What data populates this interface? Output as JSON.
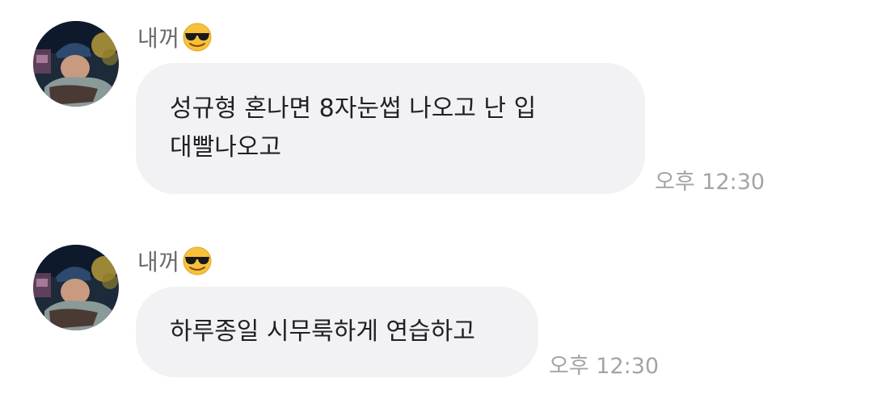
{
  "messages": [
    {
      "sender": "내꺼",
      "sender_emoji": "smiling-face-with-sunglasses",
      "text": "성규형 혼나면 8자눈썹 나오고 난 입\n대빨나오고",
      "time": "오후 12:30"
    },
    {
      "sender": "내꺼",
      "sender_emoji": "smiling-face-with-sunglasses",
      "text": "하루종일 시무룩하게 연습하고",
      "time": "오후 12:30"
    }
  ],
  "colors": {
    "bubble": "#f2f2f4",
    "text": "#202124",
    "sender": "#6b6b6f",
    "time": "#a4a4a8",
    "background": "#ffffff"
  }
}
